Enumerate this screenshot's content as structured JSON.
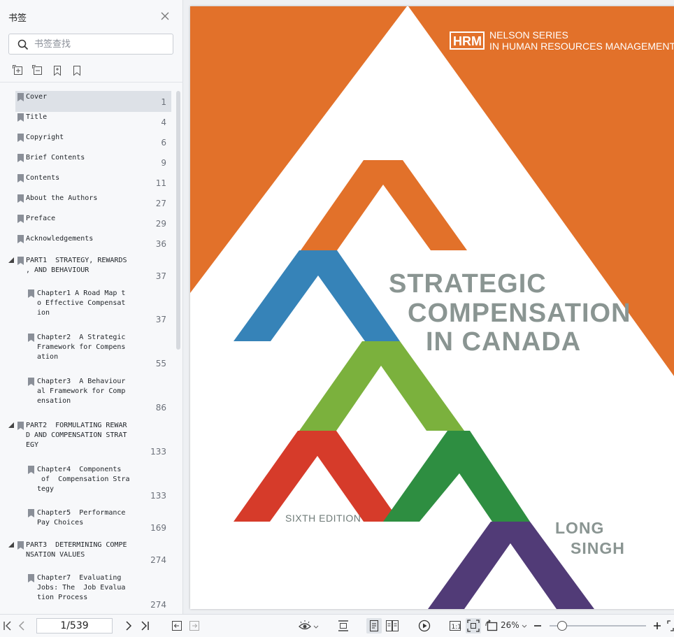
{
  "sidebar": {
    "title": "书签",
    "search_placeholder": "书签查找",
    "bookmarks": [
      {
        "label": "Cover",
        "page": "1"
      },
      {
        "label": "Title",
        "page": "4"
      },
      {
        "label": "Copyright",
        "page": "6"
      },
      {
        "label": "Brief Contents",
        "page": "9"
      },
      {
        "label": "Contents",
        "page": "11"
      },
      {
        "label": "About the Authors",
        "page": "27"
      },
      {
        "label": "Preface",
        "page": "29"
      },
      {
        "label": "Acknowledgements",
        "page": "36"
      },
      {
        "label": "PART1  STRATEGY, REWARDS\n, AND BEHAVIOUR",
        "page": "37"
      },
      {
        "label": "Chapter1 A Road Map t\no Effective Compensat\nion",
        "page": "37"
      },
      {
        "label": "Chapter2  A Strategic\nFramework for Compens\nation",
        "page": "55"
      },
      {
        "label": "Chapter3  A Behaviour\nal Framework for Comp\nensation",
        "page": "86"
      },
      {
        "label": "PART2  FORMULATING REWAR\nD AND COMPENSATION STRAT\nEGY",
        "page": "133"
      },
      {
        "label": "Chapter4  Components\n of  Compensation Stra\ntegy",
        "page": "133"
      },
      {
        "label": "Chapter5  Performance\nPay Choices",
        "page": "169"
      },
      {
        "label": "PART3  DETERMINING COMPE\nNSATION VALUES",
        "page": "274"
      },
      {
        "label": "Chapter7  Evaluating\nJobs: The  Job Evalua\ntion Process",
        "page": "274"
      }
    ]
  },
  "cover": {
    "hrm_badge": "HRM",
    "series_line1": "NELSON SERIES",
    "series_line2": "IN HUMAN RESOURCES MANAGEMENT",
    "title_line1": "STRATEGIC",
    "title_line2": "COMPENSATION",
    "title_line3": "IN CANADA",
    "edition": "SIXTH EDITION",
    "author1": "LONG",
    "author2": "SINGH",
    "colors": {
      "orange": "#e2712a",
      "blue": "#3683b8",
      "light_green": "#7bb13d",
      "red": "#d63b2a",
      "green": "#2e8e41",
      "purple": "#513b77",
      "title_gray": "#8a9592"
    }
  },
  "toolbar": {
    "page_value": "1/539",
    "zoom": "26%"
  }
}
